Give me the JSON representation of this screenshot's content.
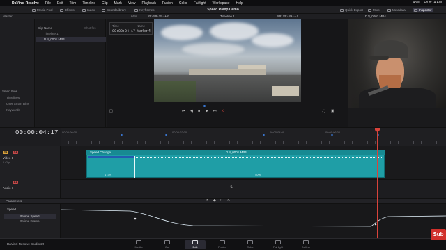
{
  "menubar": {
    "app_name": "DaVinci Resolve",
    "items": [
      "File",
      "Edit",
      "Trim",
      "Timeline",
      "Clip",
      "Mark",
      "View",
      "Playback",
      "Fusion",
      "Color",
      "Fairlight",
      "Workspace",
      "Help"
    ],
    "status": [
      "43%",
      "Fri 8:14 AM"
    ]
  },
  "toolbar": {
    "left": [
      "Media Pool",
      "Effects",
      "Index",
      "Sound Library",
      "Keyframes"
    ],
    "title": "Speed Ramp Demo",
    "right": [
      "Quick Export",
      "Mixer",
      "Metadata",
      "Inspector"
    ],
    "zoom": "66%",
    "src_tc": "00:00:04:19",
    "timeline_name": "Timeline 1",
    "rec_tc": "00:00:04:17",
    "clip_name": "DJI_0001.MP4"
  },
  "master": {
    "title": "Master",
    "smart_bins": "Smart Bins",
    "bins": [
      "Timelines",
      "User Smart Bins",
      "Keywords"
    ]
  },
  "mediapool": {
    "col_header": "Clip Name",
    "col2": "Shot fps",
    "items": [
      "Timeline 1",
      "DJI_0001.MP4"
    ]
  },
  "viewer": {
    "time_label": "Time",
    "time_value": "00:00:04:17",
    "name_label": "Name",
    "name_value": "Marker 4"
  },
  "timeline": {
    "timecode": "00:00:04:17",
    "ruler_labels": [
      "00:00:00:00",
      "00:00:02:00",
      "00:00:04:00",
      "00:00:06:00"
    ],
    "tracks": {
      "v1_badge": "V1",
      "v1_name": "Video 1",
      "v1_sub": "1 Clip",
      "a1_badge": "A1",
      "a1_name": "Audio 1"
    },
    "clip": {
      "effect_label": "Speed Change",
      "name": "DJI_0001.MP4",
      "speed_left": "173%",
      "speed_right": "40%"
    }
  },
  "keyframes": {
    "params_label": "Parameters",
    "rows": [
      "Speed",
      "Retime Speed",
      "Retime Frame"
    ]
  },
  "pages": [
    "Media",
    "Cut",
    "Edit",
    "Fusion",
    "Color",
    "Fairlight",
    "Deliver"
  ],
  "active_page": "Edit",
  "footer_app": "DaVinci Resolve Studio 20",
  "overlay_logo": "Sub",
  "colors": {
    "clip": "#1f9ea6",
    "playhead": "#d8433b",
    "marker": "#3b78d4"
  },
  "chart_like": {
    "speed_curve_note": ""
  }
}
